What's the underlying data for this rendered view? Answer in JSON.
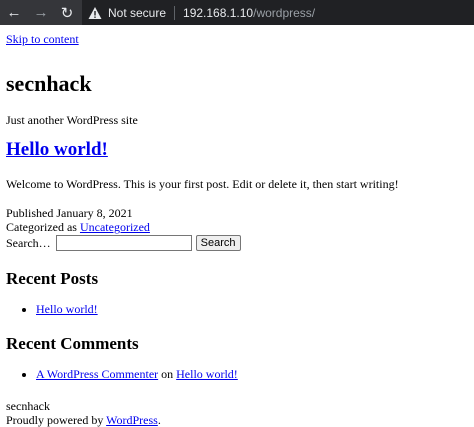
{
  "browser": {
    "security_label": "Not secure",
    "url_host": "192.168.1.10",
    "url_path": "/wordpress/",
    "icons": {
      "back": "arrow-left-icon",
      "forward": "arrow-right-icon",
      "reload": "reload-icon",
      "warning": "warning-triangle-icon"
    }
  },
  "page": {
    "skip_link": "Skip to content",
    "site_title": "secnhack",
    "tagline": "Just another WordPress site",
    "post": {
      "title": "Hello world!",
      "content": "Welcome to WordPress. This is your first post. Edit or delete it, then start writing!",
      "published_label": "Published",
      "published_date": "January 8, 2021",
      "categorized_label": "Categorized as",
      "category": "Uncategorized"
    },
    "search": {
      "label": "Search…",
      "value": "",
      "button": "Search"
    },
    "recent_posts": {
      "title": "Recent Posts",
      "items": [
        "Hello world!"
      ]
    },
    "recent_comments": {
      "title": "Recent Comments",
      "commenter": "A WordPress Commenter",
      "on": "on",
      "post": "Hello world!"
    },
    "footer": {
      "site": "secnhack",
      "powered_prefix": "Proudly powered by",
      "powered_link": "WordPress",
      "powered_suffix": "."
    }
  }
}
